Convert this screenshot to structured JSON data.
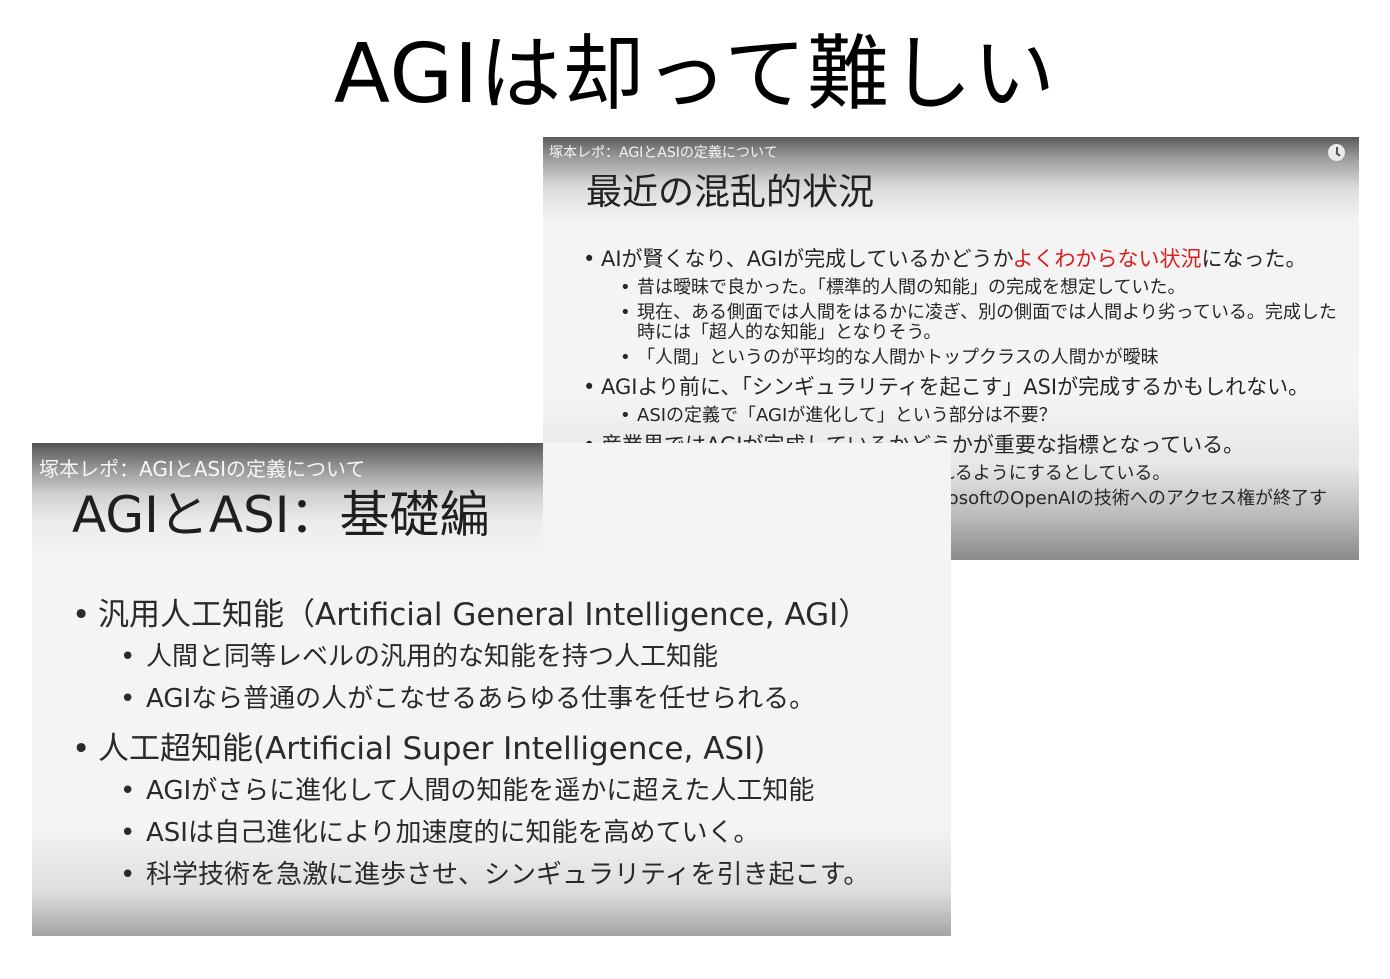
{
  "page": {
    "title": "AGIは却って難しい"
  },
  "slide_right": {
    "video_title": "塚本レポ：AGIとASIの定義について",
    "heading": "最近の混乱的状況",
    "bullets": {
      "b1": {
        "prefix": "AIが賢くなり、AGIが完成しているかどうか",
        "highlight": "よくわからない状況",
        "suffix": "になった。",
        "subs": [
          "昔は曖昧で良かった。「標準的人間の知能」の完成を想定していた。",
          "現在、ある側面では人間をはるかに凌ぎ、別の側面では人間より劣っている。完成した時には「超人的な知能」となりそう。",
          "「人間」というのが平均的な人間かトップクラスの人間かが曖昧"
        ]
      },
      "b2": {
        "text": "AGIより前に、「シンギュラリティを起こす」ASIが完成するかもしれない。",
        "subs": [
          "ASIの定義で「AGIが進化して」という部分は不要？"
        ]
      },
      "b3": {
        "text": "産業界ではAGIが完成しているかどうかが重要な指標となっている。",
        "subs": [
          "OpenAIはその利益を全人類に分配されるようにするとしている。",
          "OpenAIとMicrosoftの契約によりMicrosoftのOpenAIの技術へのアクセス権が終了する。"
        ]
      }
    },
    "highlight_color": "#d91e1e"
  },
  "slide_left": {
    "video_title": "塚本レポ：AGIとASIの定義について",
    "heading": "AGIとASI：基礎編",
    "bullets": {
      "b1": {
        "text": "汎用人工知能（Artificial General Intelligence, AGI）",
        "subs": [
          "人間と同等レベルの汎用的な知能を持つ人工知能",
          "AGIなら普通の人がこなせるあらゆる仕事を任せられる。"
        ]
      },
      "b2": {
        "text": "人工超知能(Artificial Super Intelligence, ASI)",
        "subs": [
          "AGIがさらに進化して人間の知能を遥かに超えた人工知能",
          "ASIは自己進化により加速度的に知能を高めていく。",
          "科学技術を急激に進歩させ、シンギュラリティを引き起こす。"
        ]
      }
    }
  }
}
